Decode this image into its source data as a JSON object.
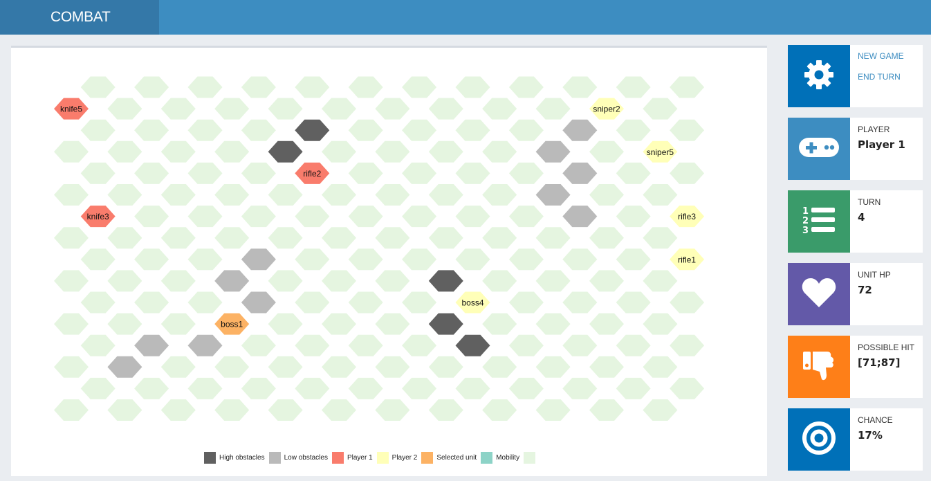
{
  "app": {
    "title": "COMBAT"
  },
  "colors": {
    "high_obstacle": "#606060",
    "low_obstacle": "#bababa",
    "player1": "#f97c6c",
    "player2": "#ffffb8",
    "selected": "#fcb264",
    "mobility": "#8dd3c7",
    "field": "#e5f5e0",
    "header": "#3d8dc1",
    "settings_tile": "#0070b8",
    "player_tile": "#3d8dc1",
    "turn_tile": "#3a9b6a",
    "hp_tile": "#6359a8",
    "hit_tile": "#fe7f18",
    "chance_tile": "#0070b8"
  },
  "board": {
    "cols": 12,
    "rows": 16,
    "units": [
      {
        "label": "knife5",
        "col": 0,
        "row": 1,
        "team": "player1"
      },
      {
        "label": "knife3",
        "col": 0,
        "row": 6,
        "team": "player1"
      },
      {
        "label": "rifle2",
        "col": 4,
        "row": 4,
        "team": "player1"
      },
      {
        "label": "boss1",
        "col": 3,
        "row": 11,
        "team": "selected"
      },
      {
        "label": "sniper2",
        "col": 10,
        "row": 1,
        "team": "player2"
      },
      {
        "label": "sniper5",
        "col": 11,
        "row": 3,
        "team": "player2"
      },
      {
        "label": "rifle3",
        "col": 11,
        "row": 6,
        "team": "player2"
      },
      {
        "label": "rifle1",
        "col": 11,
        "row": 8,
        "team": "player2"
      },
      {
        "label": "boss4",
        "col": 7,
        "row": 10,
        "team": "player2"
      }
    ],
    "high_obstacles": [
      {
        "col": 4,
        "row": 2
      },
      {
        "col": 4,
        "row": 3
      },
      {
        "col": 4,
        "row": 4
      },
      {
        "col": 7,
        "row": 9
      },
      {
        "col": 7,
        "row": 10
      },
      {
        "col": 7,
        "row": 11
      },
      {
        "col": 7,
        "row": 12
      }
    ],
    "low_obstacles": [
      {
        "col": 9,
        "row": 2
      },
      {
        "col": 9,
        "row": 3
      },
      {
        "col": 9,
        "row": 4
      },
      {
        "col": 9,
        "row": 5
      },
      {
        "col": 9,
        "row": 6
      },
      {
        "col": 3,
        "row": 8
      },
      {
        "col": 3,
        "row": 9
      },
      {
        "col": 3,
        "row": 10
      },
      {
        "col": 3,
        "row": 11
      },
      {
        "col": 2,
        "row": 12
      },
      {
        "col": 1,
        "row": 12
      },
      {
        "col": 1,
        "row": 13
      }
    ]
  },
  "legend": [
    {
      "label": "High obstacles",
      "color": "#606060"
    },
    {
      "label": "Low obstacles",
      "color": "#bababa"
    },
    {
      "label": "Player 1",
      "color": "#f97c6c"
    },
    {
      "label": "Player 2",
      "color": "#ffffb8"
    },
    {
      "label": "Selected unit",
      "color": "#fcb264"
    },
    {
      "label": "Mobility",
      "color": "#8dd3c7"
    },
    {
      "label": "",
      "color": "#e5f5e0"
    }
  ],
  "panel": {
    "new_game": "NEW GAME",
    "end_turn": "END TURN",
    "player": {
      "caption": "PLAYER",
      "value": "Player 1"
    },
    "turn": {
      "caption": "TURN",
      "value": "4"
    },
    "hp": {
      "caption": "UNIT HP",
      "value": "72"
    },
    "hit": {
      "caption": "POSSIBLE HIT",
      "value": "[71;87]"
    },
    "chance": {
      "caption": "CHANCE",
      "value": "17%"
    }
  }
}
